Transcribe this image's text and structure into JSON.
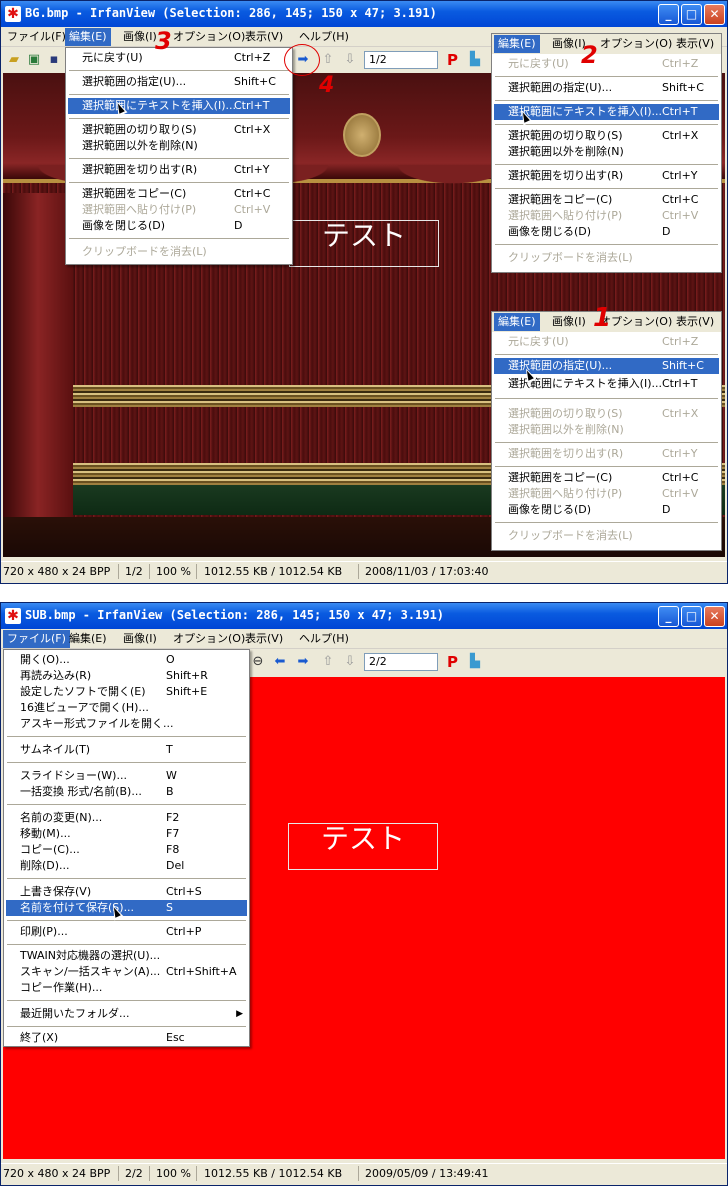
{
  "win1": {
    "title": "BG.bmp - IrfanView (Selection: 286, 145; 150 x 47; 3.191)",
    "menubar": [
      "ファイル(F)",
      "編集(E)",
      "画像(I)",
      "オプション(O)",
      "表示(V)",
      "ヘルプ(H)"
    ],
    "page_field": "1/2",
    "textbox": "テスト",
    "status": [
      "720 x 480 x 24 BPP",
      "1/2",
      "100 %",
      "1012.55 KB / 1012.54 KB",
      "2008/11/03 / 17:03:40"
    ],
    "edit_menu": {
      "items": [
        {
          "label": "元に戻す(U)",
          "shortcut": "Ctrl+Z"
        },
        {
          "label": "選択範囲の指定(U)...",
          "shortcut": "Shift+C"
        },
        {
          "label": "選択範囲にテキストを挿入(I)...",
          "shortcut": "Ctrl+T"
        },
        {
          "label": "選択範囲の切り取り(S)",
          "shortcut": "Ctrl+X"
        },
        {
          "label": "選択範囲以外を削除(N)",
          "shortcut": ""
        },
        {
          "label": "選択範囲を切り出す(R)",
          "shortcut": "Ctrl+Y"
        },
        {
          "label": "選択範囲をコピー(C)",
          "shortcut": "Ctrl+C"
        },
        {
          "label": "選択範囲へ貼り付け(P)",
          "shortcut": "Ctrl+V"
        },
        {
          "label": "画像を閉じる(D)",
          "shortcut": "D"
        },
        {
          "label": "クリップボードを消去(L)",
          "shortcut": ""
        }
      ]
    },
    "inset_top": {
      "menubar": [
        "編集(E)",
        "画像(I)",
        "オプション(O)",
        "表示(V)"
      ],
      "items": [
        {
          "label": "元に戻す(U)",
          "shortcut": "Ctrl+Z"
        },
        {
          "label": "選択範囲の指定(U)...",
          "shortcut": "Shift+C"
        },
        {
          "label": "選択範囲にテキストを挿入(I)...",
          "shortcut": "Ctrl+T"
        },
        {
          "label": "選択範囲の切り取り(S)",
          "shortcut": "Ctrl+X"
        },
        {
          "label": "選択範囲以外を削除(N)",
          "shortcut": ""
        },
        {
          "label": "選択範囲を切り出す(R)",
          "shortcut": "Ctrl+Y"
        },
        {
          "label": "選択範囲をコピー(C)",
          "shortcut": "Ctrl+C"
        },
        {
          "label": "選択範囲へ貼り付け(P)",
          "shortcut": "Ctrl+V"
        },
        {
          "label": "画像を閉じる(D)",
          "shortcut": "D"
        },
        {
          "label": "クリップボードを消去(L)",
          "shortcut": ""
        }
      ]
    },
    "inset_bottom": {
      "menubar": [
        "編集(E)",
        "画像(I)",
        "オプション(O)",
        "表示(V)"
      ],
      "items": [
        {
          "label": "元に戻す(U)",
          "shortcut": "Ctrl+Z"
        },
        {
          "label": "選択範囲の指定(U)...",
          "shortcut": "Shift+C"
        },
        {
          "label": "選択範囲にテキストを挿入(I)...",
          "shortcut": "Ctrl+T"
        },
        {
          "label": "選択範囲の切り取り(S)",
          "shortcut": "Ctrl+X"
        },
        {
          "label": "選択範囲以外を削除(N)",
          "shortcut": ""
        },
        {
          "label": "選択範囲を切り出す(R)",
          "shortcut": "Ctrl+Y"
        },
        {
          "label": "選択範囲をコピー(C)",
          "shortcut": "Ctrl+C"
        },
        {
          "label": "選択範囲へ貼り付け(P)",
          "shortcut": "Ctrl+V"
        },
        {
          "label": "画像を閉じる(D)",
          "shortcut": "D"
        },
        {
          "label": "クリップボードを消去(L)",
          "shortcut": ""
        }
      ]
    },
    "annotations": [
      "3",
      "4",
      "2",
      "1"
    ]
  },
  "win2": {
    "title": "SUB.bmp - IrfanView (Selection: 286, 145; 150 x 47; 3.191)",
    "menubar": [
      "ファイル(F)",
      "編集(E)",
      "画像(I)",
      "オプション(O)",
      "表示(V)",
      "ヘルプ(H)"
    ],
    "page_field": "2/2",
    "textbox": "テスト",
    "status": [
      "720 x 480 x 24 BPP",
      "2/2",
      "100 %",
      "1012.55 KB / 1012.54 KB",
      "2009/05/09 / 13:49:41"
    ],
    "file_menu": {
      "items": [
        {
          "label": "開く(O)...",
          "shortcut": "O"
        },
        {
          "label": "再読み込み(R)",
          "shortcut": "Shift+R"
        },
        {
          "label": "設定したソフトで開く(E)",
          "shortcut": "Shift+E"
        },
        {
          "label": "16進ビューアで開く(H)...",
          "shortcut": ""
        },
        {
          "label": "アスキー形式ファイルを開く...",
          "shortcut": ""
        },
        {
          "label": "サムネイル(T)",
          "shortcut": "T"
        },
        {
          "label": "スライドショー(W)...",
          "shortcut": "W"
        },
        {
          "label": "一括変換 形式/名前(B)...",
          "shortcut": "B"
        },
        {
          "label": "名前の変更(N)...",
          "shortcut": "F2"
        },
        {
          "label": "移動(M)...",
          "shortcut": "F7"
        },
        {
          "label": "コピー(C)...",
          "shortcut": "F8"
        },
        {
          "label": "削除(D)...",
          "shortcut": "Del"
        },
        {
          "label": "上書き保存(V)",
          "shortcut": "Ctrl+S"
        },
        {
          "label": "名前を付けて保存(S)...",
          "shortcut": "S"
        },
        {
          "label": "印刷(P)...",
          "shortcut": "Ctrl+P"
        },
        {
          "label": "TWAIN対応機器の選択(U)...",
          "shortcut": ""
        },
        {
          "label": "スキャン/一括スキャン(A)...",
          "shortcut": "Ctrl+Shift+A"
        },
        {
          "label": "コピー作業(H)...",
          "shortcut": ""
        },
        {
          "label": "最近開いたフォルダ...",
          "shortcut": ""
        },
        {
          "label": "終了(X)",
          "shortcut": "Esc"
        }
      ]
    }
  },
  "colors": {
    "titlebar": "#0a5be0",
    "highlight": "#316ac5",
    "annotation": "#e00000",
    "canvas2": "#ff0000"
  },
  "icons": [
    "irfanview-app-icon",
    "minimize-icon",
    "maximize-icon",
    "close-icon",
    "open-folder-icon",
    "slideshow-icon",
    "save-icon",
    "next-arrow-icon",
    "prev-arrow-icon",
    "up-arrow-icon",
    "down-arrow-icon",
    "zoom-out-icon",
    "paint-icon",
    "submenu-arrow-icon",
    "mouse-cursor-icon"
  ]
}
